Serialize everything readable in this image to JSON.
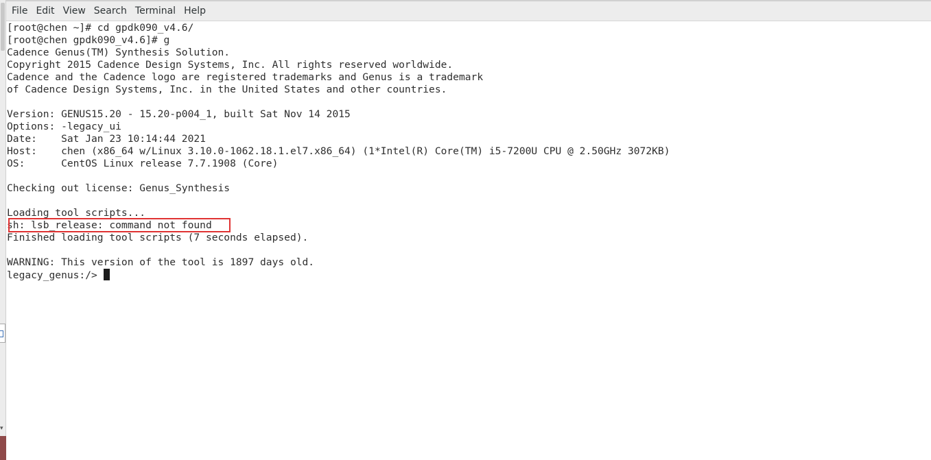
{
  "menubar": {
    "items": [
      "File",
      "Edit",
      "View",
      "Search",
      "Terminal",
      "Help"
    ]
  },
  "terminal": {
    "lines": [
      "[root@chen ~]# cd gpdk090_v4.6/",
      "[root@chen gpdk090_v4.6]# g",
      "Cadence Genus(TM) Synthesis Solution.",
      "Copyright 2015 Cadence Design Systems, Inc. All rights reserved worldwide.",
      "Cadence and the Cadence logo are registered trademarks and Genus is a trademark",
      "of Cadence Design Systems, Inc. in the United States and other countries.",
      "",
      "Version: GENUS15.20 - 15.20-p004_1, built Sat Nov 14 2015",
      "Options: -legacy_ui",
      "Date:    Sat Jan 23 10:14:44 2021",
      "Host:    chen (x86_64 w/Linux 3.10.0-1062.18.1.el7.x86_64) (1*Intel(R) Core(TM) i5-7200U CPU @ 2.50GHz 3072KB)",
      "OS:      CentOS Linux release 7.7.1908 (Core)",
      "",
      "Checking out license: Genus_Synthesis",
      "",
      "Loading tool scripts...",
      "sh: lsb_release: command not found",
      "Finished loading tool scripts (7 seconds elapsed).",
      "",
      "WARNING: This version of the tool is 1897 days old."
    ],
    "prompt": "legacy_genus:/> "
  },
  "colors": {
    "highlight": "#e03232",
    "text": "#2e2e2e",
    "menubar_bg": "#ededed"
  }
}
